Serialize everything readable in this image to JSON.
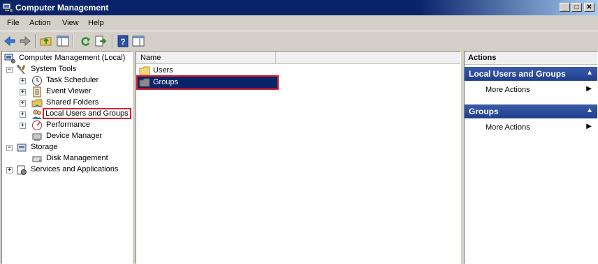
{
  "window": {
    "title": "Computer Management",
    "controls": {
      "minimize": "_",
      "maximize": "□",
      "close": "✕"
    }
  },
  "menu": [
    "File",
    "Action",
    "View",
    "Help"
  ],
  "toolbar": {
    "icons": [
      "back-icon",
      "forward-icon",
      "up-folder-icon",
      "show-hide-tree-icon",
      "refresh-icon",
      "export-list-icon",
      "help-icon",
      "show-hide-action-pane-icon"
    ]
  },
  "tree": {
    "root": "Computer Management (Local)",
    "system_tools": "System Tools",
    "task_scheduler": "Task Scheduler",
    "event_viewer": "Event Viewer",
    "shared_folders": "Shared Folders",
    "local_users_groups": "Local Users and Groups",
    "performance": "Performance",
    "device_manager": "Device Manager",
    "storage": "Storage",
    "disk_management": "Disk Management",
    "services_apps": "Services and Applications"
  },
  "list": {
    "column_name": "Name",
    "items": [
      "Users",
      "Groups"
    ],
    "selected": "Groups"
  },
  "actions": {
    "header": "Actions",
    "sections": [
      {
        "title": "Local Users and Groups",
        "item": "More Actions"
      },
      {
        "title": "Groups",
        "item": "More Actions"
      }
    ]
  },
  "colors": {
    "title_bar": "#0a246a",
    "selection": "#0a246a",
    "action_section": "#2a4a98",
    "highlight_box": "#e0202a"
  }
}
